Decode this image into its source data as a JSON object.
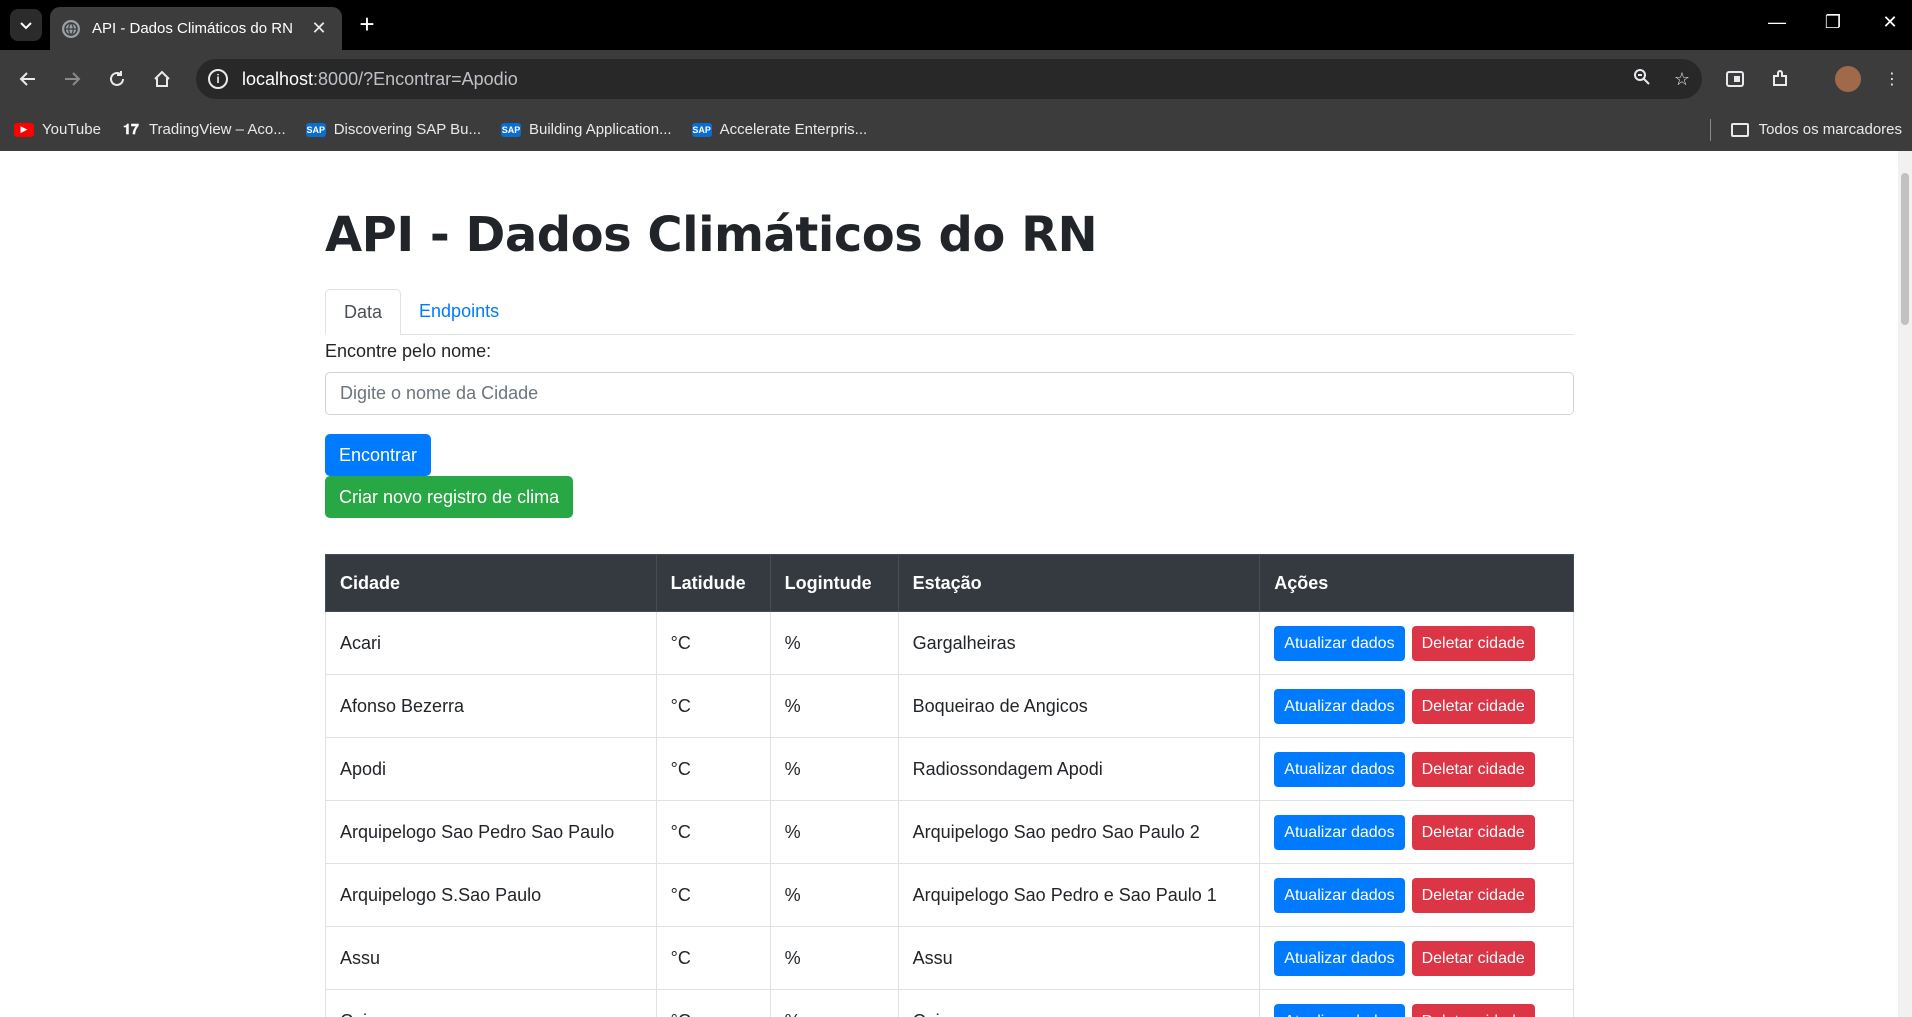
{
  "browser": {
    "tab_title": "API - Dados Climáticos do RN",
    "url_host": "localhost",
    "url_rest": ":8000/?Encontrar=Apodio",
    "bookmarks": [
      {
        "label": "YouTube",
        "icon": "youtube-icon"
      },
      {
        "label": "TradingView – Aco...",
        "icon": "tradingview-icon"
      },
      {
        "label": "Discovering SAP Bu...",
        "icon": "sap-icon"
      },
      {
        "label": "Building Application...",
        "icon": "sap-icon"
      },
      {
        "label": "Accelerate Enterpris...",
        "icon": "sap-icon"
      }
    ],
    "all_bookmarks_label": "Todos os marcadores"
  },
  "page": {
    "title": "API - Dados Climáticos do RN",
    "tabs": [
      {
        "label": "Data",
        "active": true
      },
      {
        "label": "Endpoints",
        "active": false
      }
    ],
    "search_label": "Encontre pelo nome:",
    "search_placeholder": "Digite o nome da Cidade",
    "find_button": "Encontrar",
    "create_button": "Criar novo registro de clima"
  },
  "table": {
    "headers": [
      "Cidade",
      "Latidude",
      "Logintude",
      "Estação",
      "Ações"
    ],
    "update_label": "Atualizar dados",
    "delete_label": "Deletar cidade",
    "rows": [
      {
        "cidade": "Acari",
        "lat": "°C",
        "lon": "%",
        "estacao": "Gargalheiras"
      },
      {
        "cidade": "Afonso Bezerra",
        "lat": "°C",
        "lon": "%",
        "estacao": "Boqueirao de Angicos"
      },
      {
        "cidade": "Apodi",
        "lat": "°C",
        "lon": "%",
        "estacao": "Radiossondagem Apodi"
      },
      {
        "cidade": "Arquipelogo Sao Pedro Sao Paulo",
        "lat": "°C",
        "lon": "%",
        "estacao": "Arquipelogo Sao pedro Sao Paulo 2"
      },
      {
        "cidade": "Arquipelogo S.Sao Paulo",
        "lat": "°C",
        "lon": "%",
        "estacao": "Arquipelogo Sao Pedro e Sao Paulo 1"
      },
      {
        "cidade": "Assu",
        "lat": "°C",
        "lon": "%",
        "estacao": "Assu"
      },
      {
        "cidade": "Caico",
        "lat": "°C",
        "lon": "%",
        "estacao": "Caico"
      }
    ]
  },
  "colors": {
    "primary": "#007bff",
    "success": "#28a745",
    "danger": "#dc3545",
    "table_header": "#343a40"
  }
}
